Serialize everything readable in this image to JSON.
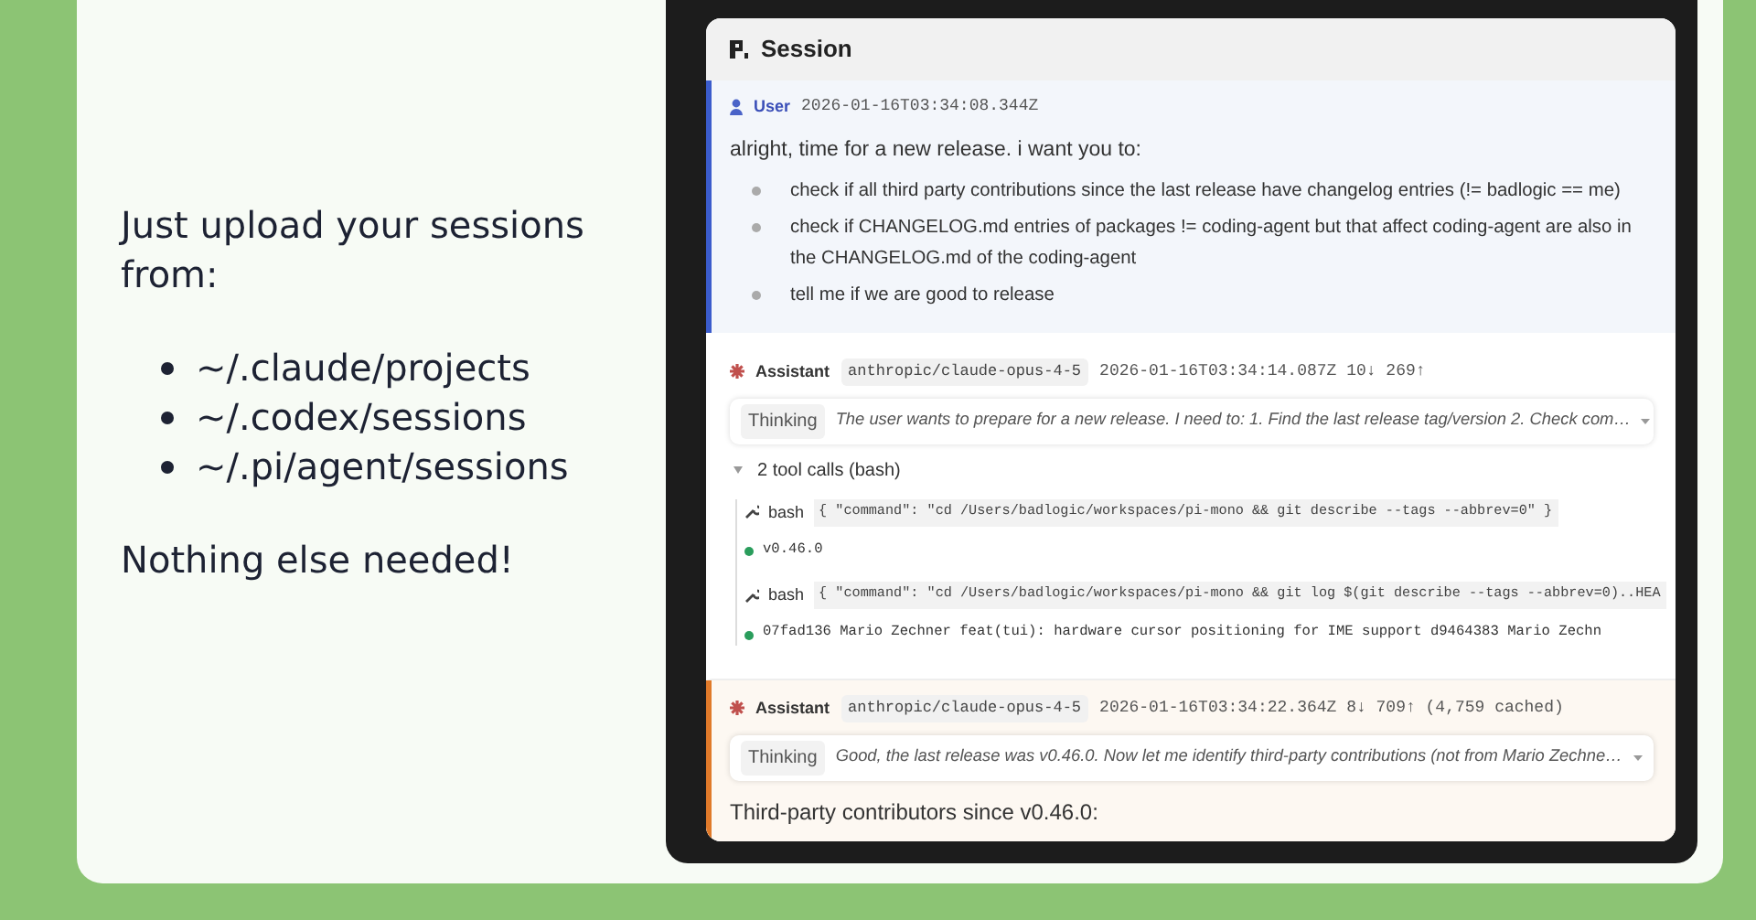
{
  "slide": {
    "intro": "Just upload your sessions from:",
    "paths": [
      "~/.claude/projects",
      "~/.codex/sessions",
      "~/.pi/agent/sessions"
    ],
    "closing": "Nothing else needed!"
  },
  "session": {
    "title": "Session",
    "messages": [
      {
        "kind": "user",
        "role": "User",
        "timestamp": "2026-01-16T03:34:08.344Z",
        "text": "alright, time for a new release. i want you to:",
        "items": [
          "check if all third party contributions since the last release have changelog entries (!= badlogic == me)",
          "check if CHANGELOG.md entries of packages != coding-agent but that affect coding-agent are also in the CHANGELOG.md of the coding-agent",
          "tell me if we are good to release"
        ]
      },
      {
        "kind": "assistant",
        "role": "Assistant",
        "highlighted": false,
        "model": "anthropic/claude-opus-4-5",
        "meta": "2026-01-16T03:34:14.087Z 10↓ 269↑",
        "thinking": {
          "label": "Thinking",
          "text": "The user wants to prepare for a new release. I need to: 1. Find the last release tag/version 2. Check com…"
        },
        "tools": {
          "label": "2 tool calls (bash)",
          "expanded": true,
          "calls": [
            {
              "tool": "bash",
              "args": "{ \"command\": \"cd /Users/badlogic/workspaces/pi-mono && git describe --tags --abbrev=0\" }",
              "result": "v0.46.0"
            },
            {
              "tool": "bash",
              "args": "{ \"command\": \"cd /Users/badlogic/workspaces/pi-mono && git log $(git describe --tags --abbrev=0)..HEA",
              "result": "07fad136 Mario Zechner feat(tui): hardware cursor positioning for IME support d9464383 Mario Zechn"
            }
          ]
        }
      },
      {
        "kind": "assistant",
        "role": "Assistant",
        "highlighted": true,
        "model": "anthropic/claude-opus-4-5",
        "meta": "2026-01-16T03:34:22.364Z 8↓ 709↑ (4,759 cached)",
        "thinking": {
          "label": "Thinking",
          "text": "Good, the last release was v0.46.0. Now let me identify third-party contributions (not from Mario Zechne…"
        },
        "text": "Third-party contributors since v0.46.0:"
      }
    ]
  }
}
